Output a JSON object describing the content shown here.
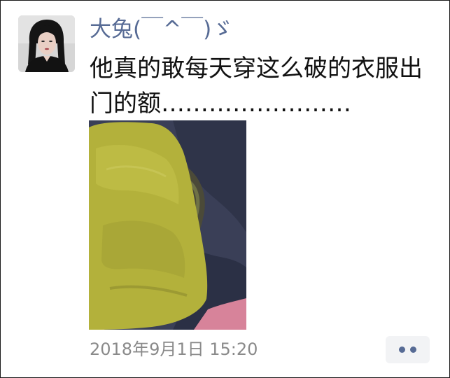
{
  "post": {
    "author": {
      "nickname": "大兔(￣^￣)ゞ",
      "avatar": "avatar-photo"
    },
    "text": "他真的敢每天穿这么破的衣服出门的额……………………",
    "photo": "photo-of-worn-yellow-shirt",
    "timestamp": "2018年9月1日 15:20",
    "more_icon": "two-dots-icon"
  },
  "colors": {
    "nickname": "#576b95",
    "text": "#111111",
    "timestamp": "#8a8a8a",
    "more_button_bg": "#f2f3f5",
    "more_dots": "#576b95"
  }
}
